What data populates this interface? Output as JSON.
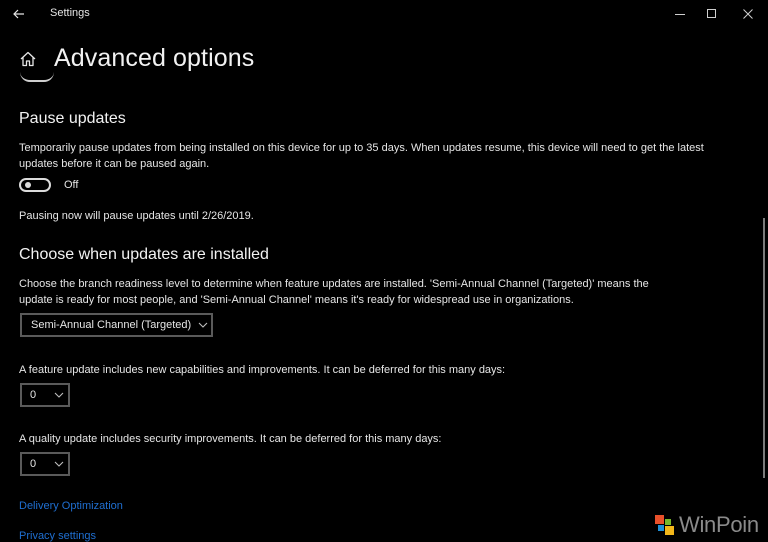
{
  "window": {
    "app_title": "Settings",
    "back_icon": "back-arrow-icon",
    "controls": {
      "minimize_icon": "minimize-icon",
      "maximize_icon": "maximize-icon",
      "close_icon": "close-icon"
    }
  },
  "header": {
    "home_icon": "home-icon",
    "title": "Advanced options"
  },
  "previous_toggle": {
    "label": "Off"
  },
  "pause_updates": {
    "title": "Pause updates",
    "description": "Temporarily pause updates from being installed on this device for up to 35 days. When updates resume, this device will need to get the latest updates before it can be paused again.",
    "toggle": {
      "state": "off",
      "label": "Off"
    },
    "status": "Pausing now will pause updates until 2/26/2019."
  },
  "choose_when": {
    "title": "Choose when updates are installed",
    "description": "Choose the branch readiness level to determine when feature updates are installed. 'Semi-Annual Channel (Targeted)' means the update is ready for most people, and 'Semi-Annual Channel' means it's ready for widespread use in organizations.",
    "branch_select": {
      "selected": "Semi-Annual Channel (Targeted)"
    },
    "feature_update": {
      "label": "A feature update includes new capabilities and improvements. It can be deferred for this many days:",
      "selected": "0"
    },
    "quality_update": {
      "label": "A quality update includes security improvements. It can be deferred for this many days:",
      "selected": "0"
    }
  },
  "links": {
    "delivery_optimization": "Delivery Optimization",
    "privacy_settings": "Privacy settings"
  },
  "colors": {
    "background": "#000000",
    "text": "#e6e6e6",
    "link": "#1f6fd1",
    "border": "#5a5a5a"
  },
  "watermark": {
    "text": "WinPoin",
    "logo_colors": [
      "#e8502a",
      "#78b82a",
      "#1e8fd6",
      "#f2b61a"
    ]
  }
}
